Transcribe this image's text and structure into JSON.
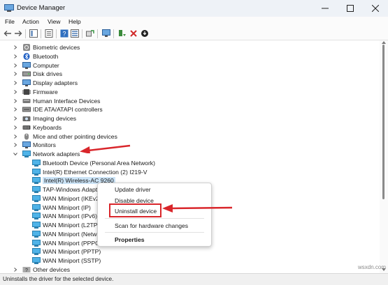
{
  "window": {
    "title": "Device Manager"
  },
  "menu": [
    "File",
    "Action",
    "View",
    "Help"
  ],
  "tree": {
    "categories_top": [
      "Biometric devices",
      "Bluetooth",
      "Computer",
      "Disk drives",
      "Display adapters",
      "Firmware",
      "Human Interface Devices",
      "IDE ATA/ATAPI controllers",
      "Imaging devices",
      "Keyboards",
      "Mice and other pointing devices",
      "Monitors"
    ],
    "network": {
      "label": "Network adapters",
      "children": [
        "Bluetooth Device (Personal Area Network)",
        "Intel(R) Ethernet Connection (2) I219-V",
        "Intel(R) Wireless-AC 9260",
        "TAP-Windows Adapt",
        "WAN Miniport (IKEv2",
        "WAN Miniport (IP)",
        "WAN Miniport (IPv6)",
        "WAN Miniport (L2TP",
        "WAN Miniport (Netw",
        "WAN Miniport (PPPO",
        "WAN Miniport (PPTP)",
        "WAN Miniport (SSTP)"
      ]
    },
    "categories_bottom": [
      "Other devices"
    ]
  },
  "context_menu": {
    "items": [
      "Update driver",
      "Disable device",
      "Uninstall device",
      "Scan for hardware changes",
      "Properties"
    ]
  },
  "status": "Uninstalls the driver for the selected device.",
  "watermark": "wsxdn.com",
  "colors": {
    "selection": "#cce4f7",
    "annotation": "#d9262b"
  }
}
